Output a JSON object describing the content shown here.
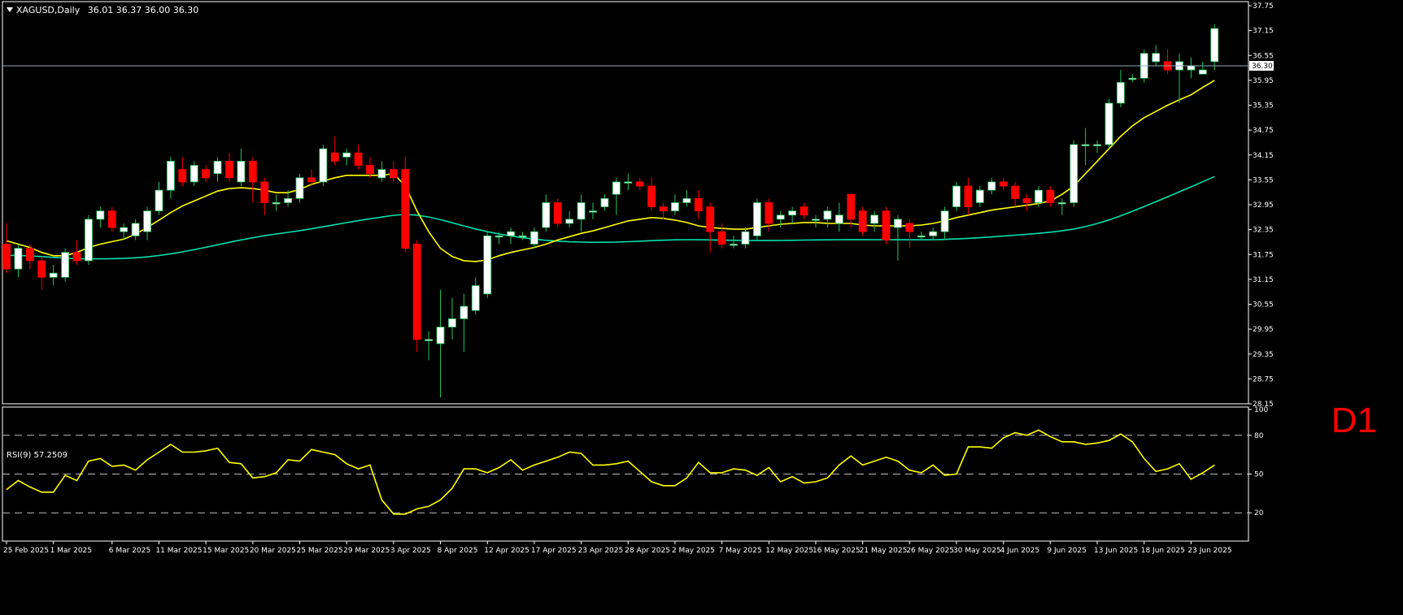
{
  "header": {
    "symbol_label": "XAGUSD,Daily",
    "ohlc_label": "36.01 36.37 36.00 36.30"
  },
  "timeframe_label": "D1",
  "rsi_header": {
    "label": "RSI(9) 57.2509"
  },
  "current_price_label": "36.30",
  "colors": {
    "background": "#000000",
    "up_candle": "#ffffff",
    "down_candle": "#ff0000",
    "ma_fast": "#ffff00",
    "ma_slow": "#00e0b0",
    "rsi_line": "#ffff00",
    "current_price_line": "#8fa9bc",
    "axis": "#ffffff",
    "timeframe": "#ff0000"
  },
  "chart_data": [
    {
      "type": "candlestick",
      "title": "XAGUSD,Daily",
      "y_ticks": [
        "37.75",
        "37.15",
        "36.55",
        "35.95",
        "35.35",
        "34.75",
        "34.15",
        "33.55",
        "32.95",
        "32.35",
        "31.75",
        "31.15",
        "30.55",
        "29.95",
        "29.35",
        "28.75",
        "28.15"
      ],
      "ylim": [
        28.15,
        37.75
      ],
      "x_tick_labels": [
        "25 Feb 2025",
        "1 Mar 2025",
        "6 Mar 2025",
        "11 Mar 2025",
        "15 Mar 2025",
        "20 Mar 2025",
        "25 Mar 2025",
        "29 Mar 2025",
        "3 Apr 2025",
        "8 Apr 2025",
        "12 Apr 2025",
        "17 Apr 2025",
        "23 Apr 2025",
        "28 Apr 2025",
        "2 May 2025",
        "7 May 2025",
        "12 May 2025",
        "16 May 2025",
        "21 May 2025",
        "26 May 2025",
        "30 May 2025",
        "4 Jun 2025",
        "9 Jun 2025",
        "13 Jun 2025",
        "18 Jun 2025",
        "23 Jun 2025"
      ],
      "x_tick_bar_index": [
        0,
        4,
        9,
        13,
        17,
        21,
        25,
        29,
        33,
        37,
        41,
        45,
        49,
        53,
        57,
        61,
        65,
        69,
        73,
        77,
        81,
        85,
        89,
        93,
        97,
        101
      ],
      "bar_count": 104,
      "current_price": 36.3,
      "candles": [
        [
          32.0,
          31.4,
          32.5,
          31.3
        ],
        [
          31.4,
          31.9,
          32.0,
          31.2
        ],
        [
          31.9,
          31.6,
          32.0,
          31.4
        ],
        [
          31.6,
          31.2,
          31.7,
          30.9
        ],
        [
          31.2,
          31.3,
          31.5,
          31.0
        ],
        [
          31.2,
          31.8,
          31.9,
          31.1
        ],
        [
          31.8,
          31.6,
          32.1,
          31.5
        ],
        [
          31.6,
          32.6,
          32.7,
          31.5
        ],
        [
          32.6,
          32.8,
          32.9,
          32.4
        ],
        [
          32.8,
          32.4,
          32.9,
          32.3
        ],
        [
          32.3,
          32.4,
          32.5,
          32.1
        ],
        [
          32.2,
          32.5,
          32.6,
          32.1
        ],
        [
          32.3,
          32.8,
          32.9,
          32.1
        ],
        [
          32.8,
          33.3,
          33.5,
          32.7
        ],
        [
          33.3,
          34.0,
          34.1,
          33.1
        ],
        [
          33.8,
          33.5,
          34.1,
          33.4
        ],
        [
          33.5,
          33.9,
          34.0,
          33.4
        ],
        [
          33.8,
          33.6,
          33.9,
          33.5
        ],
        [
          33.7,
          34.0,
          34.1,
          33.5
        ],
        [
          34.0,
          33.6,
          34.2,
          33.5
        ],
        [
          33.5,
          34.0,
          34.3,
          33.4
        ],
        [
          34.0,
          33.5,
          34.1,
          33.0
        ],
        [
          33.5,
          33.0,
          33.6,
          32.7
        ],
        [
          33.0,
          33.0,
          33.2,
          32.8
        ],
        [
          33.0,
          33.1,
          33.3,
          32.9
        ],
        [
          33.1,
          33.6,
          33.7,
          33.0
        ],
        [
          33.6,
          33.5,
          33.8,
          33.4
        ],
        [
          33.5,
          34.3,
          34.4,
          33.4
        ],
        [
          34.2,
          34.0,
          34.6,
          33.9
        ],
        [
          34.1,
          34.2,
          34.3,
          33.9
        ],
        [
          34.2,
          33.9,
          34.4,
          33.8
        ],
        [
          33.9,
          33.7,
          34.1,
          33.6
        ],
        [
          33.6,
          33.8,
          34.0,
          33.5
        ],
        [
          33.8,
          33.6,
          34.0,
          33.5
        ],
        [
          33.8,
          31.9,
          34.1,
          31.8
        ],
        [
          32.0,
          29.7,
          32.1,
          29.4
        ],
        [
          29.7,
          29.7,
          29.9,
          29.2
        ],
        [
          29.6,
          30.0,
          30.9,
          28.3
        ],
        [
          30.0,
          30.2,
          30.7,
          29.7
        ],
        [
          30.2,
          30.5,
          30.8,
          29.4
        ],
        [
          30.4,
          31.0,
          31.2,
          30.3
        ],
        [
          30.8,
          32.2,
          32.3,
          30.7
        ],
        [
          32.2,
          32.2,
          32.3,
          32.0
        ],
        [
          32.2,
          32.3,
          32.4,
          32.0
        ],
        [
          32.2,
          32.2,
          32.3,
          32.1
        ],
        [
          32.0,
          32.3,
          32.4,
          31.9
        ],
        [
          32.4,
          33.0,
          33.2,
          32.3
        ],
        [
          33.0,
          32.5,
          33.1,
          32.4
        ],
        [
          32.5,
          32.6,
          32.8,
          32.4
        ],
        [
          32.6,
          33.0,
          33.2,
          32.3
        ],
        [
          32.8,
          32.8,
          33.0,
          32.6
        ],
        [
          32.9,
          33.1,
          33.2,
          32.8
        ],
        [
          33.2,
          33.5,
          33.6,
          32.7
        ],
        [
          33.5,
          33.5,
          33.7,
          33.3
        ],
        [
          33.5,
          33.4,
          33.6,
          33.3
        ],
        [
          33.4,
          32.9,
          33.6,
          32.8
        ],
        [
          32.9,
          32.8,
          33.0,
          32.6
        ],
        [
          32.8,
          33.0,
          33.2,
          32.7
        ],
        [
          33.0,
          33.1,
          33.3,
          32.9
        ],
        [
          33.1,
          32.8,
          33.3,
          32.6
        ],
        [
          32.9,
          32.3,
          33.0,
          31.8
        ],
        [
          32.3,
          32.0,
          32.5,
          31.9
        ],
        [
          32.0,
          32.0,
          32.2,
          31.9
        ],
        [
          32.0,
          32.3,
          32.4,
          31.9
        ],
        [
          32.2,
          33.0,
          33.1,
          32.1
        ],
        [
          33.0,
          32.5,
          33.1,
          32.3
        ],
        [
          32.6,
          32.7,
          32.8,
          32.4
        ],
        [
          32.7,
          32.8,
          32.9,
          32.5
        ],
        [
          32.9,
          32.7,
          33.0,
          32.6
        ],
        [
          32.6,
          32.6,
          32.7,
          32.4
        ],
        [
          32.6,
          32.8,
          32.9,
          32.4
        ],
        [
          32.5,
          32.7,
          33.0,
          32.3
        ],
        [
          33.2,
          32.6,
          33.2,
          32.4
        ],
        [
          32.8,
          32.3,
          32.9,
          32.2
        ],
        [
          32.5,
          32.7,
          32.8,
          32.3
        ],
        [
          32.8,
          32.1,
          32.9,
          32.0
        ],
        [
          32.4,
          32.6,
          32.7,
          31.6
        ],
        [
          32.5,
          32.3,
          32.6,
          31.9
        ],
        [
          32.2,
          32.2,
          32.3,
          32.1
        ],
        [
          32.2,
          32.3,
          32.4,
          32.1
        ],
        [
          32.3,
          32.8,
          32.9,
          32.1
        ],
        [
          32.9,
          33.4,
          33.5,
          32.8
        ],
        [
          33.4,
          32.9,
          33.6,
          32.7
        ],
        [
          33.0,
          33.3,
          33.4,
          32.9
        ],
        [
          33.3,
          33.5,
          33.6,
          33.2
        ],
        [
          33.5,
          33.4,
          33.6,
          33.3
        ],
        [
          33.4,
          33.1,
          33.5,
          32.9
        ],
        [
          33.1,
          33.0,
          33.2,
          32.8
        ],
        [
          33.0,
          33.3,
          33.4,
          32.9
        ],
        [
          33.3,
          33.0,
          33.4,
          32.9
        ],
        [
          33.0,
          33.0,
          33.1,
          32.7
        ],
        [
          33.0,
          34.4,
          34.5,
          32.9
        ],
        [
          34.4,
          34.4,
          34.8,
          33.9
        ],
        [
          34.4,
          34.4,
          34.5,
          34.2
        ],
        [
          34.4,
          35.4,
          35.5,
          34.3
        ],
        [
          35.4,
          35.9,
          36.2,
          35.3
        ],
        [
          36.0,
          36.0,
          36.1,
          35.9
        ],
        [
          36.0,
          36.6,
          36.7,
          35.9
        ],
        [
          36.4,
          36.6,
          36.8,
          36.3
        ],
        [
          36.4,
          36.2,
          36.7,
          36.1
        ],
        [
          36.2,
          36.4,
          36.6,
          35.4
        ],
        [
          36.2,
          36.3,
          36.5,
          36.0
        ],
        [
          36.1,
          36.2,
          36.4,
          36.1
        ],
        [
          36.4,
          37.2,
          37.3,
          36.2
        ]
      ],
      "ma_fast": [
        32.08,
        32.0,
        31.92,
        31.8,
        31.72,
        31.72,
        31.8,
        31.92,
        32.0,
        32.06,
        32.12,
        32.24,
        32.4,
        32.58,
        32.76,
        32.92,
        33.04,
        33.16,
        33.28,
        33.34,
        33.36,
        33.34,
        33.3,
        33.24,
        33.24,
        33.32,
        33.44,
        33.52,
        33.6,
        33.66,
        33.66,
        33.66,
        33.66,
        33.7,
        33.4,
        32.8,
        32.3,
        31.9,
        31.7,
        31.6,
        31.58,
        31.62,
        31.72,
        31.8,
        31.86,
        31.92,
        32.0,
        32.1,
        32.18,
        32.26,
        32.32,
        32.4,
        32.48,
        32.56,
        32.6,
        32.64,
        32.62,
        32.58,
        32.52,
        32.44,
        32.4,
        32.38,
        32.36,
        32.36,
        32.4,
        32.44,
        32.48,
        32.5,
        32.52,
        32.52,
        32.5,
        32.5,
        32.5,
        32.46,
        32.44,
        32.44,
        32.44,
        32.44,
        32.46,
        32.5,
        32.56,
        32.64,
        32.7,
        32.76,
        32.82,
        32.86,
        32.9,
        32.94,
        32.98,
        33.04,
        33.2,
        33.4,
        33.7,
        34.0,
        34.3,
        34.6,
        34.85,
        35.05,
        35.2,
        35.35,
        35.48,
        35.6,
        35.78,
        35.95
      ]
    },
    {
      "type": "line",
      "title": "RSI(9) 57.2509",
      "ylim": [
        0,
        100
      ],
      "y_ticks": [
        100,
        80,
        50,
        20
      ],
      "levels": [
        80,
        50,
        20
      ],
      "values": [
        38,
        45,
        40,
        36,
        36,
        49,
        45,
        60,
        62,
        56,
        57,
        53,
        61,
        67,
        73,
        67,
        67,
        68,
        70,
        59,
        58,
        47,
        48,
        51,
        61,
        60,
        69,
        67,
        65,
        58,
        54,
        57,
        30,
        19,
        19,
        23,
        25,
        30,
        39,
        54,
        54,
        51,
        55,
        61,
        53,
        57,
        60,
        63,
        67,
        66,
        57,
        57,
        58,
        60,
        52,
        44,
        41,
        41,
        47,
        59,
        51,
        51,
        54,
        53,
        49,
        55,
        44,
        48,
        43,
        44,
        47,
        57,
        64,
        57,
        60,
        63,
        60,
        53,
        51,
        57,
        49,
        50,
        71,
        71,
        70,
        78,
        82,
        80,
        84,
        79,
        75,
        75,
        73,
        74,
        76,
        81,
        75,
        62,
        52,
        54,
        58,
        46,
        51,
        57
      ]
    }
  ]
}
